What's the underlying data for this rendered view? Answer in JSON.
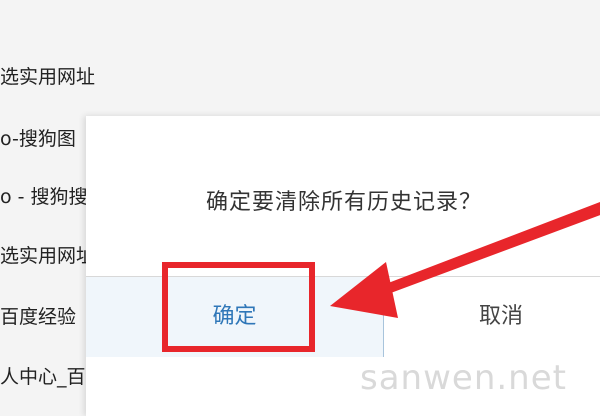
{
  "background_list": [
    "选实用网址",
    "o-搜狗图",
    "o - 搜狗搜",
    "选实用网址",
    "百度经验",
    "人中心_百度经验"
  ],
  "dialog": {
    "message": "确定要清除所有历史记录？",
    "confirm_label": "确定",
    "cancel_label": "取消"
  },
  "annotation": {
    "color": "#e8262b"
  },
  "watermark": "sanwen.net",
  "icons": {
    "arrow": "red-arrow"
  }
}
